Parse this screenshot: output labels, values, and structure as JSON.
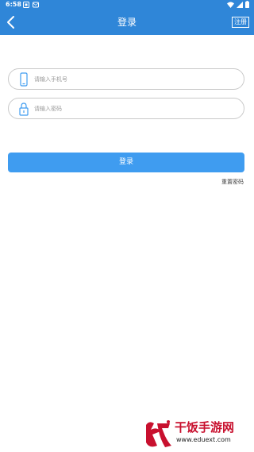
{
  "status_bar": {
    "time": "6:58"
  },
  "app_bar": {
    "title": "登录",
    "register_label": "注册"
  },
  "form": {
    "phone_placeholder": "请输入手机号",
    "password_placeholder": "请输入密码",
    "login_label": "登录",
    "reset_password_label": "重置密码"
  },
  "watermark": {
    "title": "干饭手游网",
    "url": "www.eduext.com"
  },
  "colors": {
    "primary": "#2f86d8",
    "button": "#3f9cf0",
    "field_border": "#c9c9c9",
    "watermark_red": "#c8102e"
  },
  "icons": [
    "back-arrow-icon",
    "phone-icon",
    "lock-icon",
    "wifi-icon",
    "signal-icon",
    "battery-icon"
  ]
}
